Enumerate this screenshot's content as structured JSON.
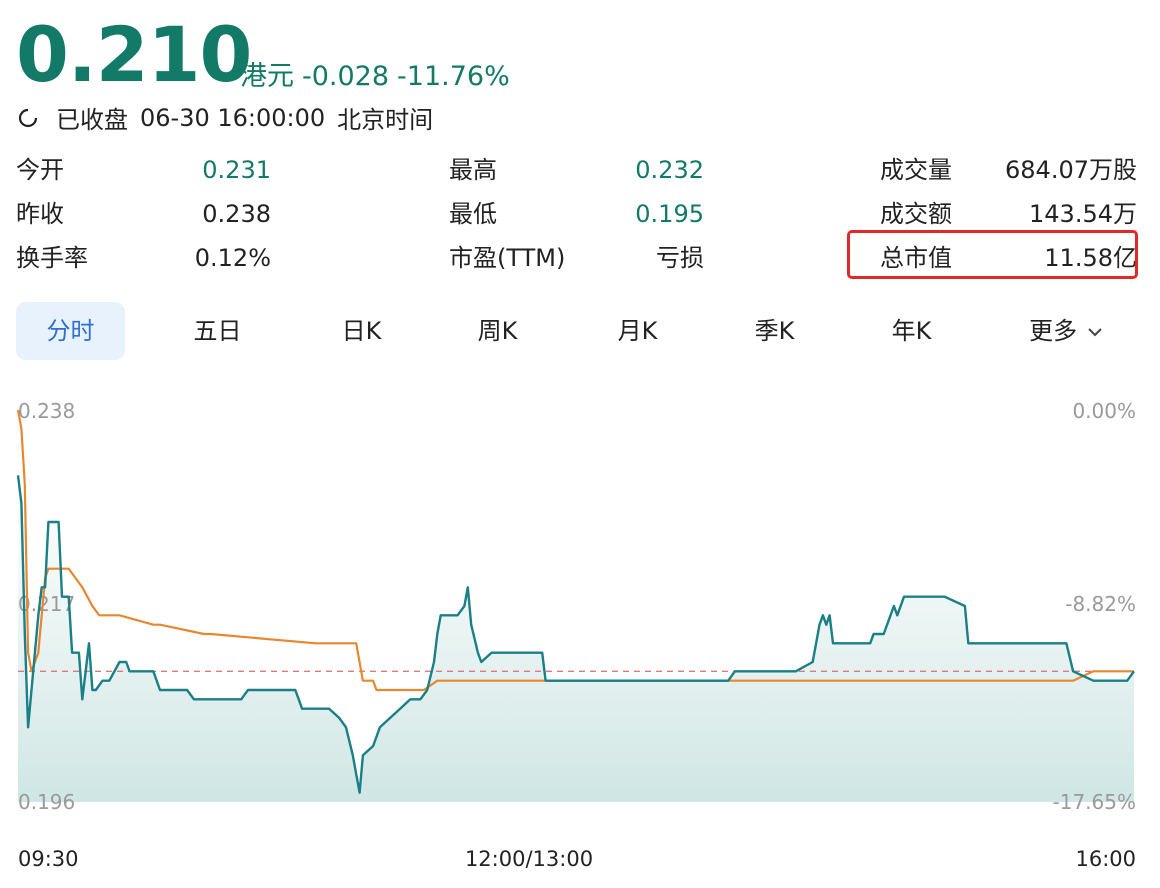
{
  "header": {
    "price": "0.210",
    "currency": "港元",
    "change": "-0.028",
    "change_pct": "-11.76%",
    "status": "已收盘",
    "datetime": "06-30 16:00:00",
    "timezone": "北京时间",
    "status_icon": "clock-icon"
  },
  "stats": {
    "open_label": "今开",
    "open_value": "0.231",
    "prev_close_label": "昨收",
    "prev_close_value": "0.238",
    "turnover_rate_label": "换手率",
    "turnover_rate_value": "0.12%",
    "high_label": "最高",
    "high_value": "0.232",
    "low_label": "最低",
    "low_value": "0.195",
    "pe_label": "市盈(TTM)",
    "pe_value": "亏损",
    "volume_label": "成交量",
    "volume_value": "684.07万股",
    "amount_label": "成交额",
    "amount_value": "143.54万",
    "market_cap_label": "总市值",
    "market_cap_value": "11.58亿"
  },
  "tabs": [
    "分时",
    "五日",
    "日K",
    "周K",
    "月K",
    "季K",
    "年K",
    "更多"
  ],
  "active_tab": "分时",
  "colors": {
    "accent": "#127a66",
    "price_line": "#1a7f86",
    "avg_line": "#e8872e",
    "ref_line": "#e07a7a",
    "highlight": "#e02a2a",
    "active_tab_bg": "#e8f2fd",
    "active_tab_text": "#2f6fd3"
  },
  "chart_data": {
    "type": "line",
    "y_left_labels": [
      "0.238",
      "0.217",
      "0.196"
    ],
    "y_right_labels": [
      "0.00%",
      "-8.82%",
      "-17.65%"
    ],
    "x_labels": [
      "09:30",
      "12:00/13:00",
      "16:00"
    ],
    "ylim": [
      0.196,
      0.238
    ],
    "reference_value": 0.21,
    "x_range": [
      0,
      330
    ],
    "series": [
      {
        "name": "price",
        "color": "#1a7f86",
        "points": [
          [
            0,
            0.231
          ],
          [
            1,
            0.228
          ],
          [
            2,
            0.214
          ],
          [
            3,
            0.204
          ],
          [
            5,
            0.212
          ],
          [
            6,
            0.216
          ],
          [
            7,
            0.219
          ],
          [
            8,
            0.219
          ],
          [
            9,
            0.226
          ],
          [
            12,
            0.226
          ],
          [
            13,
            0.218
          ],
          [
            15,
            0.218
          ],
          [
            16,
            0.212
          ],
          [
            18,
            0.212
          ],
          [
            19,
            0.207
          ],
          [
            21,
            0.213
          ],
          [
            22,
            0.208
          ],
          [
            23,
            0.208
          ],
          [
            25,
            0.209
          ],
          [
            27,
            0.209
          ],
          [
            30,
            0.211
          ],
          [
            32,
            0.211
          ],
          [
            33,
            0.21
          ],
          [
            40,
            0.21
          ],
          [
            42,
            0.208
          ],
          [
            50,
            0.208
          ],
          [
            52,
            0.207
          ],
          [
            66,
            0.207
          ],
          [
            68,
            0.208
          ],
          [
            82,
            0.208
          ],
          [
            84,
            0.206
          ],
          [
            92,
            0.206
          ],
          [
            95,
            0.205
          ],
          [
            97,
            0.204
          ],
          [
            99,
            0.201
          ],
          [
            100,
            0.199
          ],
          [
            101,
            0.197
          ],
          [
            102,
            0.201
          ],
          [
            105,
            0.202
          ],
          [
            107,
            0.204
          ],
          [
            110,
            0.205
          ],
          [
            113,
            0.206
          ],
          [
            116,
            0.207
          ],
          [
            119,
            0.207
          ],
          [
            121,
            0.208
          ],
          [
            123,
            0.211
          ],
          [
            124,
            0.214
          ],
          [
            125,
            0.216
          ],
          [
            130,
            0.216
          ],
          [
            132,
            0.217
          ],
          [
            133,
            0.219
          ],
          [
            134,
            0.215
          ],
          [
            136,
            0.212
          ],
          [
            137,
            0.211
          ],
          [
            140,
            0.212
          ],
          [
            155,
            0.212
          ],
          [
            156,
            0.209
          ],
          [
            157,
            0.209
          ],
          [
            158,
            0.209
          ],
          [
            180,
            0.209
          ],
          [
            210,
            0.209
          ],
          [
            212,
            0.21
          ],
          [
            230,
            0.21
          ],
          [
            235,
            0.211
          ],
          [
            237,
            0.215
          ],
          [
            238,
            0.216
          ],
          [
            239,
            0.215
          ],
          [
            240,
            0.216
          ],
          [
            241,
            0.213
          ],
          [
            252,
            0.213
          ],
          [
            253,
            0.214
          ],
          [
            256,
            0.214
          ],
          [
            259,
            0.217
          ],
          [
            260,
            0.216
          ],
          [
            262,
            0.218
          ],
          [
            274,
            0.218
          ],
          [
            280,
            0.217
          ],
          [
            281,
            0.213
          ],
          [
            310,
            0.213
          ],
          [
            312,
            0.21
          ],
          [
            318,
            0.209
          ],
          [
            328,
            0.209
          ],
          [
            330,
            0.21
          ]
        ]
      },
      {
        "name": "avg",
        "color": "#e8872e",
        "points": [
          [
            0,
            0.238
          ],
          [
            1,
            0.236
          ],
          [
            2,
            0.23
          ],
          [
            3,
            0.212
          ],
          [
            4,
            0.21
          ],
          [
            6,
            0.212
          ],
          [
            7,
            0.216
          ],
          [
            8,
            0.22
          ],
          [
            9,
            0.221
          ],
          [
            15,
            0.221
          ],
          [
            17,
            0.22
          ],
          [
            19,
            0.219
          ],
          [
            22,
            0.217
          ],
          [
            24,
            0.216
          ],
          [
            30,
            0.216
          ],
          [
            40,
            0.215
          ],
          [
            42,
            0.215
          ],
          [
            55,
            0.214
          ],
          [
            57,
            0.214
          ],
          [
            88,
            0.213
          ],
          [
            90,
            0.213
          ],
          [
            100,
            0.213
          ],
          [
            102,
            0.209
          ],
          [
            105,
            0.209
          ],
          [
            106,
            0.208
          ],
          [
            120,
            0.208
          ],
          [
            124,
            0.209
          ],
          [
            160,
            0.209
          ],
          [
            260,
            0.209
          ],
          [
            290,
            0.209
          ],
          [
            312,
            0.209
          ],
          [
            318,
            0.21
          ],
          [
            330,
            0.21
          ]
        ]
      }
    ]
  }
}
